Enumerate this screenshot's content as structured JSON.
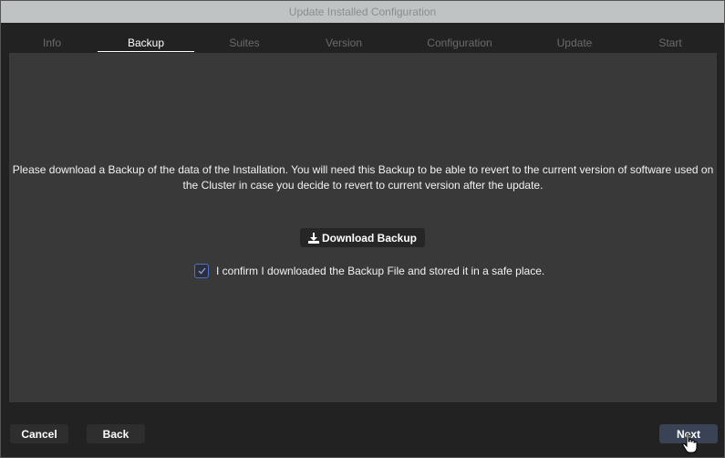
{
  "window": {
    "title": "Update Installed Configuration"
  },
  "tabs": [
    {
      "label": "Info",
      "active": false
    },
    {
      "label": "Backup",
      "active": true
    },
    {
      "label": "Suites",
      "active": false
    },
    {
      "label": "Version",
      "active": false
    },
    {
      "label": "Configuration",
      "active": false
    },
    {
      "label": "Update",
      "active": false
    },
    {
      "label": "Start",
      "active": false
    }
  ],
  "main": {
    "message_line1": "Please download a Backup of the data of the Installation. You will need this Backup to be able to revert to the current version of software used on",
    "message_line2": "the Cluster in case you decide to revert to current version after the update.",
    "download_label": "Download Backup",
    "download_icon": "download-icon",
    "confirm_label": "I confirm I downloaded the Backup File and stored it in a safe place.",
    "confirm_checked": true
  },
  "footer": {
    "cancel_label": "Cancel",
    "back_label": "Back",
    "next_label": "Next"
  },
  "colors": {
    "accent": "#4e6fcf",
    "panel": "#393939",
    "background": "#222222"
  }
}
